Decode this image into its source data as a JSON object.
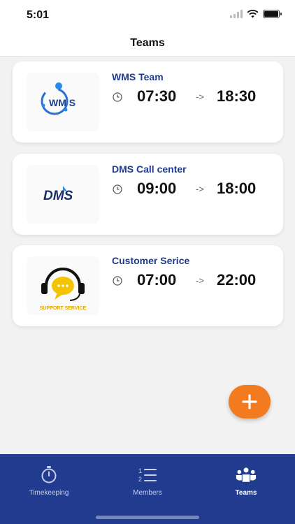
{
  "status_bar": {
    "time": "5:01"
  },
  "header": {
    "title": "Teams"
  },
  "teams": [
    {
      "name": "WMS Team",
      "start": "07:30",
      "arrow": "->",
      "end": "18:30",
      "logo_text": "WM S"
    },
    {
      "name": "DMS Call center",
      "start": "09:00",
      "arrow": "->",
      "end": "18:00",
      "logo_text": "DMS"
    },
    {
      "name": "Customer Serice",
      "start": "07:00",
      "arrow": "->",
      "end": "22:00",
      "logo_text": "SUPPORT SERVICE"
    }
  ],
  "fab": {
    "icon": "plus-icon",
    "color": "#f47a20"
  },
  "tab_bar": {
    "background": "#213b8f",
    "items": [
      {
        "label": "Timekeeping",
        "icon": "stopwatch-icon"
      },
      {
        "label": "Members",
        "icon": "numbered-list-icon"
      },
      {
        "label": "Teams",
        "icon": "team-icon",
        "active": true
      }
    ]
  }
}
